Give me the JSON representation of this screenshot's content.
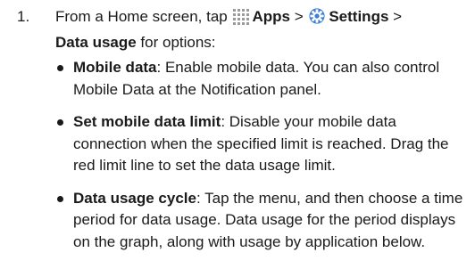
{
  "step": {
    "number": "1.",
    "intro_prefix": "From a Home screen, tap ",
    "apps_label": "Apps",
    "sep1": " > ",
    "settings_label": "Settings",
    "sep2": " >",
    "data_usage_label": "Data usage",
    "intro_suffix": " for options:",
    "apps_icon": "apps-grid-icon",
    "settings_icon": "settings-gear-icon",
    "accent_color": "#3d7fd6"
  },
  "bullets": [
    {
      "term": "Mobile data",
      "desc": ": Enable mobile data. You can also control Mobile Data at the Notification panel."
    },
    {
      "term": "Set mobile data limit",
      "desc": ": Disable your mobile data connection when the specified limit is reached. Drag the red limit line to set the data usage limit."
    },
    {
      "term": "Data usage cycle",
      "desc": ": Tap the menu, and then choose a time period for data usage. Data usage for the period displays on the graph, along with usage by application below."
    }
  ]
}
